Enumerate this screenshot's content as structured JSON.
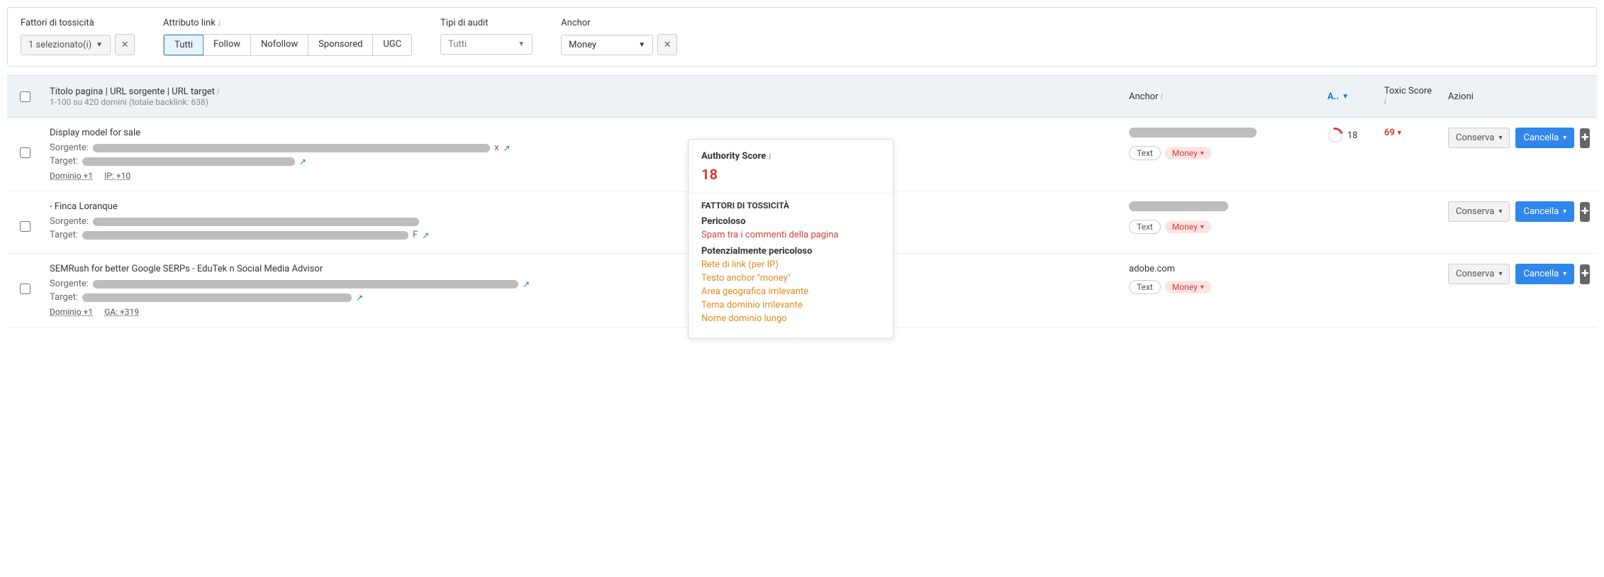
{
  "filters": {
    "toxicity": {
      "label": "Fattori di tossicità",
      "selected": "1 selezionato(i)"
    },
    "link_attr": {
      "label": "Attributo link",
      "options": [
        "Tutti",
        "Follow",
        "Nofollow",
        "Sponsored",
        "UGC"
      ],
      "active": "Tutti"
    },
    "audit_types": {
      "label": "Tipi di audit",
      "selected": "Tutti"
    },
    "anchor": {
      "label": "Anchor",
      "selected": "Money"
    }
  },
  "table": {
    "headers": {
      "title": "Titolo pagina | URL sorgente | URL target",
      "subtitle": "1-100 su 420 domini (totale backlink: 638)",
      "anchor": "Anchor",
      "as": "A..",
      "toxic": "Toxic Score",
      "actions": "Azioni"
    },
    "rows": [
      {
        "title": "Display model for sale",
        "source_prefix": "Sorgente:",
        "target_prefix": "Target:",
        "source_suffix": "x",
        "sub_links": [
          "Dominio +1",
          "IP: +10"
        ],
        "anchor_tags": [
          "Text",
          "Money"
        ],
        "as_value": "18",
        "toxic": "69"
      },
      {
        "title": "- Finca Loranque",
        "source_prefix": "Sorgente:",
        "target_prefix": "Target:",
        "target_suffix": "F",
        "sub_links": [],
        "anchor_tags": [
          "Text",
          "Money"
        ],
        "as_value": "",
        "toxic": ""
      },
      {
        "title": "SEMRush for better Google SERPs - EduTek n Social Media Advisor",
        "source_prefix": "Sorgente:",
        "target_prefix": "Target:",
        "anchor_domain": "adobe.com",
        "sub_links": [
          "Dominio +1",
          "GA: +319"
        ],
        "anchor_tags": [
          "Text",
          "Money"
        ],
        "as_value": "",
        "toxic": ""
      }
    ]
  },
  "actions": {
    "keep": "Conserva",
    "delete": "Cancella"
  },
  "popover": {
    "as_label": "Authority Score",
    "as_value": "18",
    "section_title": "Fattori di tossicità",
    "dangerous_label": "Pericoloso",
    "dangerous_items": [
      "Spam tra i commenti della pagina"
    ],
    "potential_label": "Potenzialmente pericoloso",
    "potential_items": [
      "Rete di link (per IP)",
      "Testo anchor \"money\"",
      "Area geografica irrilevante",
      "Tema dominio irrilevante",
      "Nome dominio lungo"
    ]
  }
}
